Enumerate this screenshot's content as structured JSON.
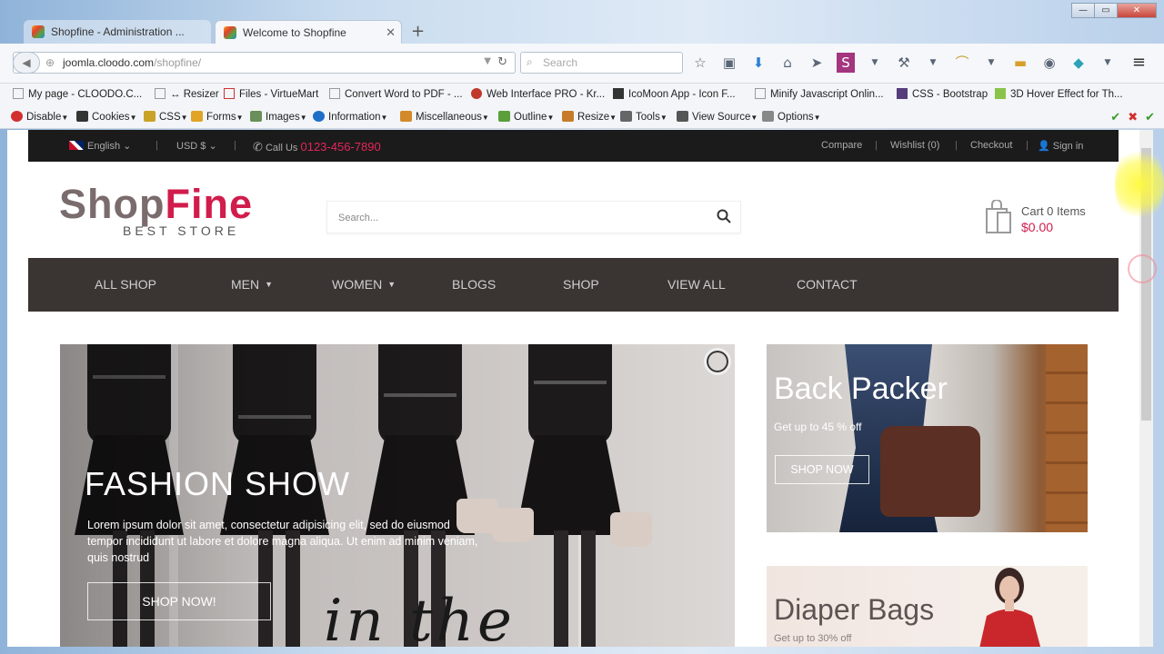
{
  "browser": {
    "tabs": [
      {
        "title": "Shopfine - Administration ...",
        "active": false
      },
      {
        "title": "Welcome to Shopfine",
        "active": true
      }
    ],
    "new_tab": "+",
    "url_host": "joomla.cloodo.com",
    "url_path": "/shopfine/",
    "search_placeholder": "Search",
    "window_buttons": {
      "minimize": "—",
      "maximize": "▭",
      "close": "✕"
    }
  },
  "bookmarks": [
    "My page - CLOODO.C...",
    "↔ Resizer",
    "Files - VirtueMart",
    "Convert Word to PDF - ...",
    "Web Interface PRO - Kr...",
    "IcoMoon App - Icon F...",
    "Minify Javascript Onlin...",
    "CSS - Bootstrap",
    "3D Hover Effect for Th..."
  ],
  "devtools": [
    "Disable",
    "Cookies",
    "CSS",
    "Forms",
    "Images",
    "Information",
    "Miscellaneous",
    "Outline",
    "Resize",
    "Tools",
    "View Source",
    "Options"
  ],
  "topbar": {
    "language": "English",
    "separator": "|",
    "currency": "USD $",
    "call_label": "Call Us",
    "phone": "0123-456-7890",
    "links": [
      "Compare",
      "Wishlist (0)",
      "Checkout",
      "Sign in"
    ]
  },
  "header": {
    "logo_shop": "Shop",
    "logo_fine": "Fine",
    "logo_sub": "BEST STORE",
    "search_placeholder": "Search...",
    "cart_label": "Cart 0 Items",
    "cart_total": "$0.00"
  },
  "nav": [
    "ALL SHOP",
    "MEN",
    "WOMEN",
    "BLOGS",
    "SHOP",
    "VIEW ALL",
    "CONTACT"
  ],
  "hero": {
    "title": "FASHION SHOW",
    "description": "Lorem ipsum dolor sit amet, consectetur adipisicing elit, sed do eiusmod tempor incididunt ut labore et dolore magna aliqua. Ut enim ad minim veniam, quis nostrud",
    "button": "SHOP NOW!",
    "script_text": "in the"
  },
  "promo_backpack": {
    "title": "Back Packer",
    "subtitle": "Get up to 45 % off",
    "button": "SHOP NOW"
  },
  "promo_diaper": {
    "title": "Diaper Bags",
    "subtitle": "Get up to 30% off"
  },
  "colors": {
    "brand_red": "#d11c4c",
    "nav_bg": "#3a3432",
    "topbar_bg": "#1b1b1b"
  }
}
